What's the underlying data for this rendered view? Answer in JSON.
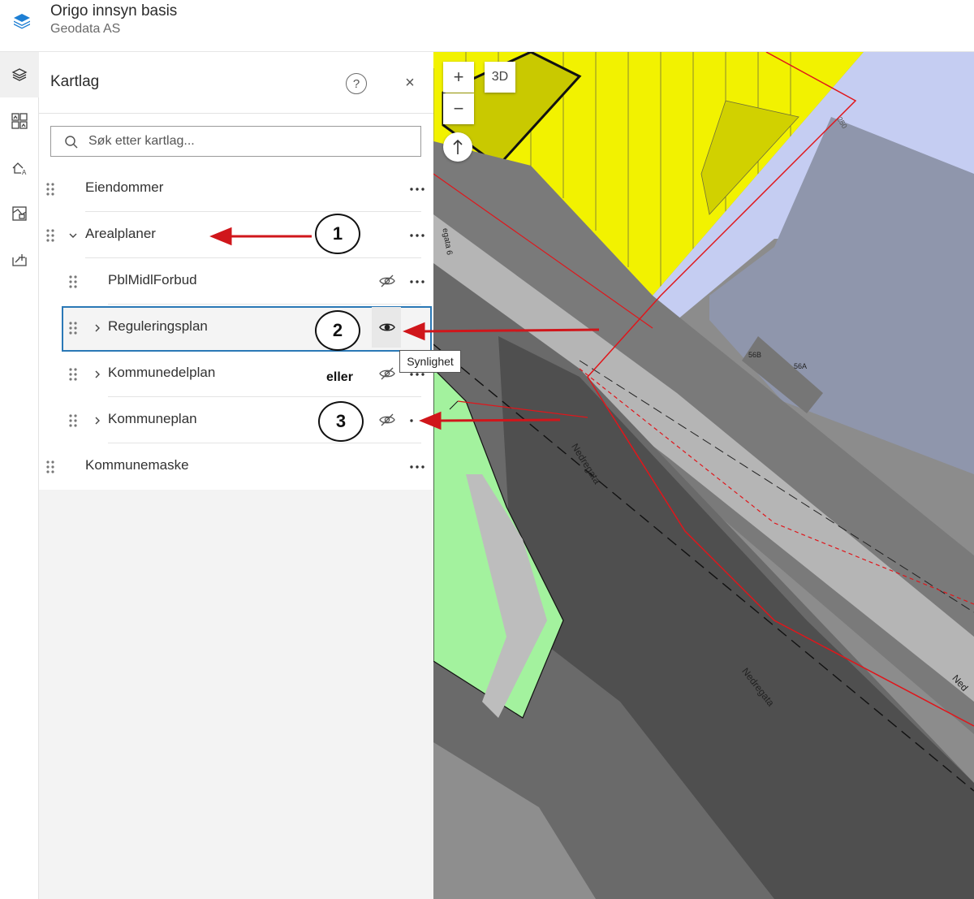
{
  "app": {
    "title": "Origo innsyn basis",
    "subtitle": "Geodata AS"
  },
  "rail": {
    "items": [
      "layers-icon",
      "basemap-icon",
      "legend-icon",
      "map-layers-icon",
      "add-data-icon"
    ]
  },
  "panel": {
    "title": "Kartlag",
    "help_label": "?",
    "close_label": "×",
    "search_placeholder": "Søk etter kartlag..."
  },
  "layers": [
    {
      "label": "Eiendommer",
      "level": 0,
      "expandable": false,
      "visibility_toggle": false
    },
    {
      "label": "Arealplaner",
      "level": 0,
      "expandable": true,
      "expanded": true,
      "visibility_toggle": false
    },
    {
      "label": "PblMidlForbud",
      "level": 1,
      "expandable": false,
      "visibility_toggle": true,
      "visible": false
    },
    {
      "label": "Reguleringsplan",
      "level": 1,
      "expandable": true,
      "expanded": false,
      "visibility_toggle": true,
      "visible": true,
      "selected": true
    },
    {
      "label": "Kommunedelplan",
      "level": 1,
      "expandable": true,
      "expanded": false,
      "visibility_toggle": true,
      "visible": false
    },
    {
      "label": "Kommuneplan",
      "level": 1,
      "expandable": true,
      "expanded": false,
      "visibility_toggle": true,
      "visible": false
    },
    {
      "label": "Kommunemaske",
      "level": 0,
      "expandable": false,
      "visibility_toggle": false
    }
  ],
  "tooltip": "Synlighet",
  "annotations": {
    "one": "1",
    "two": "2",
    "three": "3",
    "or_text": "eller"
  },
  "map": {
    "zoom_in": "+",
    "zoom_out": "−",
    "view_3d": "3D",
    "labels": {
      "street_main": "Nedregata",
      "street_lower": "Nedregata",
      "street_edge": "Ned",
      "street_top": "egata 6",
      "contour": "250",
      "building_a": "56B",
      "building_b": "56A"
    }
  },
  "colors": {
    "accent": "#2a78b6",
    "annotation_arrow": "#d0161b",
    "map_yellow": "#f2f200",
    "map_green": "#a3f29e",
    "map_blue": "#c5cdf2",
    "logo_blue": "#1e7fd4"
  }
}
